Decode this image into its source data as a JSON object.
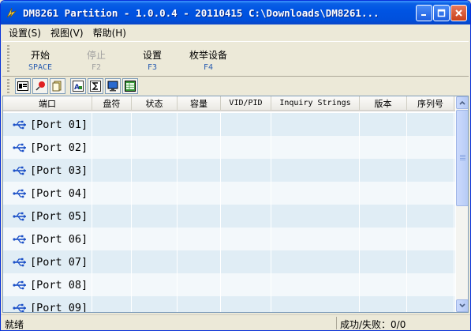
{
  "window": {
    "title": "DM8261 Partition - 1.0.0.4 - 20110415  C:\\Downloads\\DM8261...",
    "controls": {
      "minimize": "_",
      "maximize": "□",
      "close": "✕"
    }
  },
  "menu": [
    "设置(S)",
    "视图(V)",
    "帮助(H)"
  ],
  "toolbar": {
    "buttons": [
      {
        "label": "开始",
        "key": "SPACE",
        "enabled": true
      },
      {
        "label": "停止",
        "key": "F2",
        "enabled": false
      },
      {
        "label": "设置",
        "key": "F3",
        "enabled": true
      },
      {
        "label": "枚举设备",
        "key": "F4",
        "enabled": true
      }
    ]
  },
  "icon_toolbar": [
    "device-manager-icon",
    "pin-icon",
    "copy-icon",
    "font-icon",
    "sum-icon",
    "monitor-icon",
    "grid-icon"
  ],
  "columns": [
    "端口",
    "盘符",
    "状态",
    "容量",
    "VID/PID",
    "Inquiry Strings",
    "版本",
    "序列号"
  ],
  "rows": [
    {
      "port": "[Port 01]"
    },
    {
      "port": "[Port 02]"
    },
    {
      "port": "[Port 03]"
    },
    {
      "port": "[Port 04]"
    },
    {
      "port": "[Port 05]"
    },
    {
      "port": "[Port 06]"
    },
    {
      "port": "[Port 07]"
    },
    {
      "port": "[Port 08]"
    },
    {
      "port": "[Port 09]"
    }
  ],
  "status": {
    "left": "就绪",
    "right": "成功/失败：0/0"
  },
  "colors": {
    "title_bar": "#0054e3",
    "row_odd": "#e0edf5",
    "row_even": "#f3f8fb",
    "key_hint": "#2a5db0"
  }
}
